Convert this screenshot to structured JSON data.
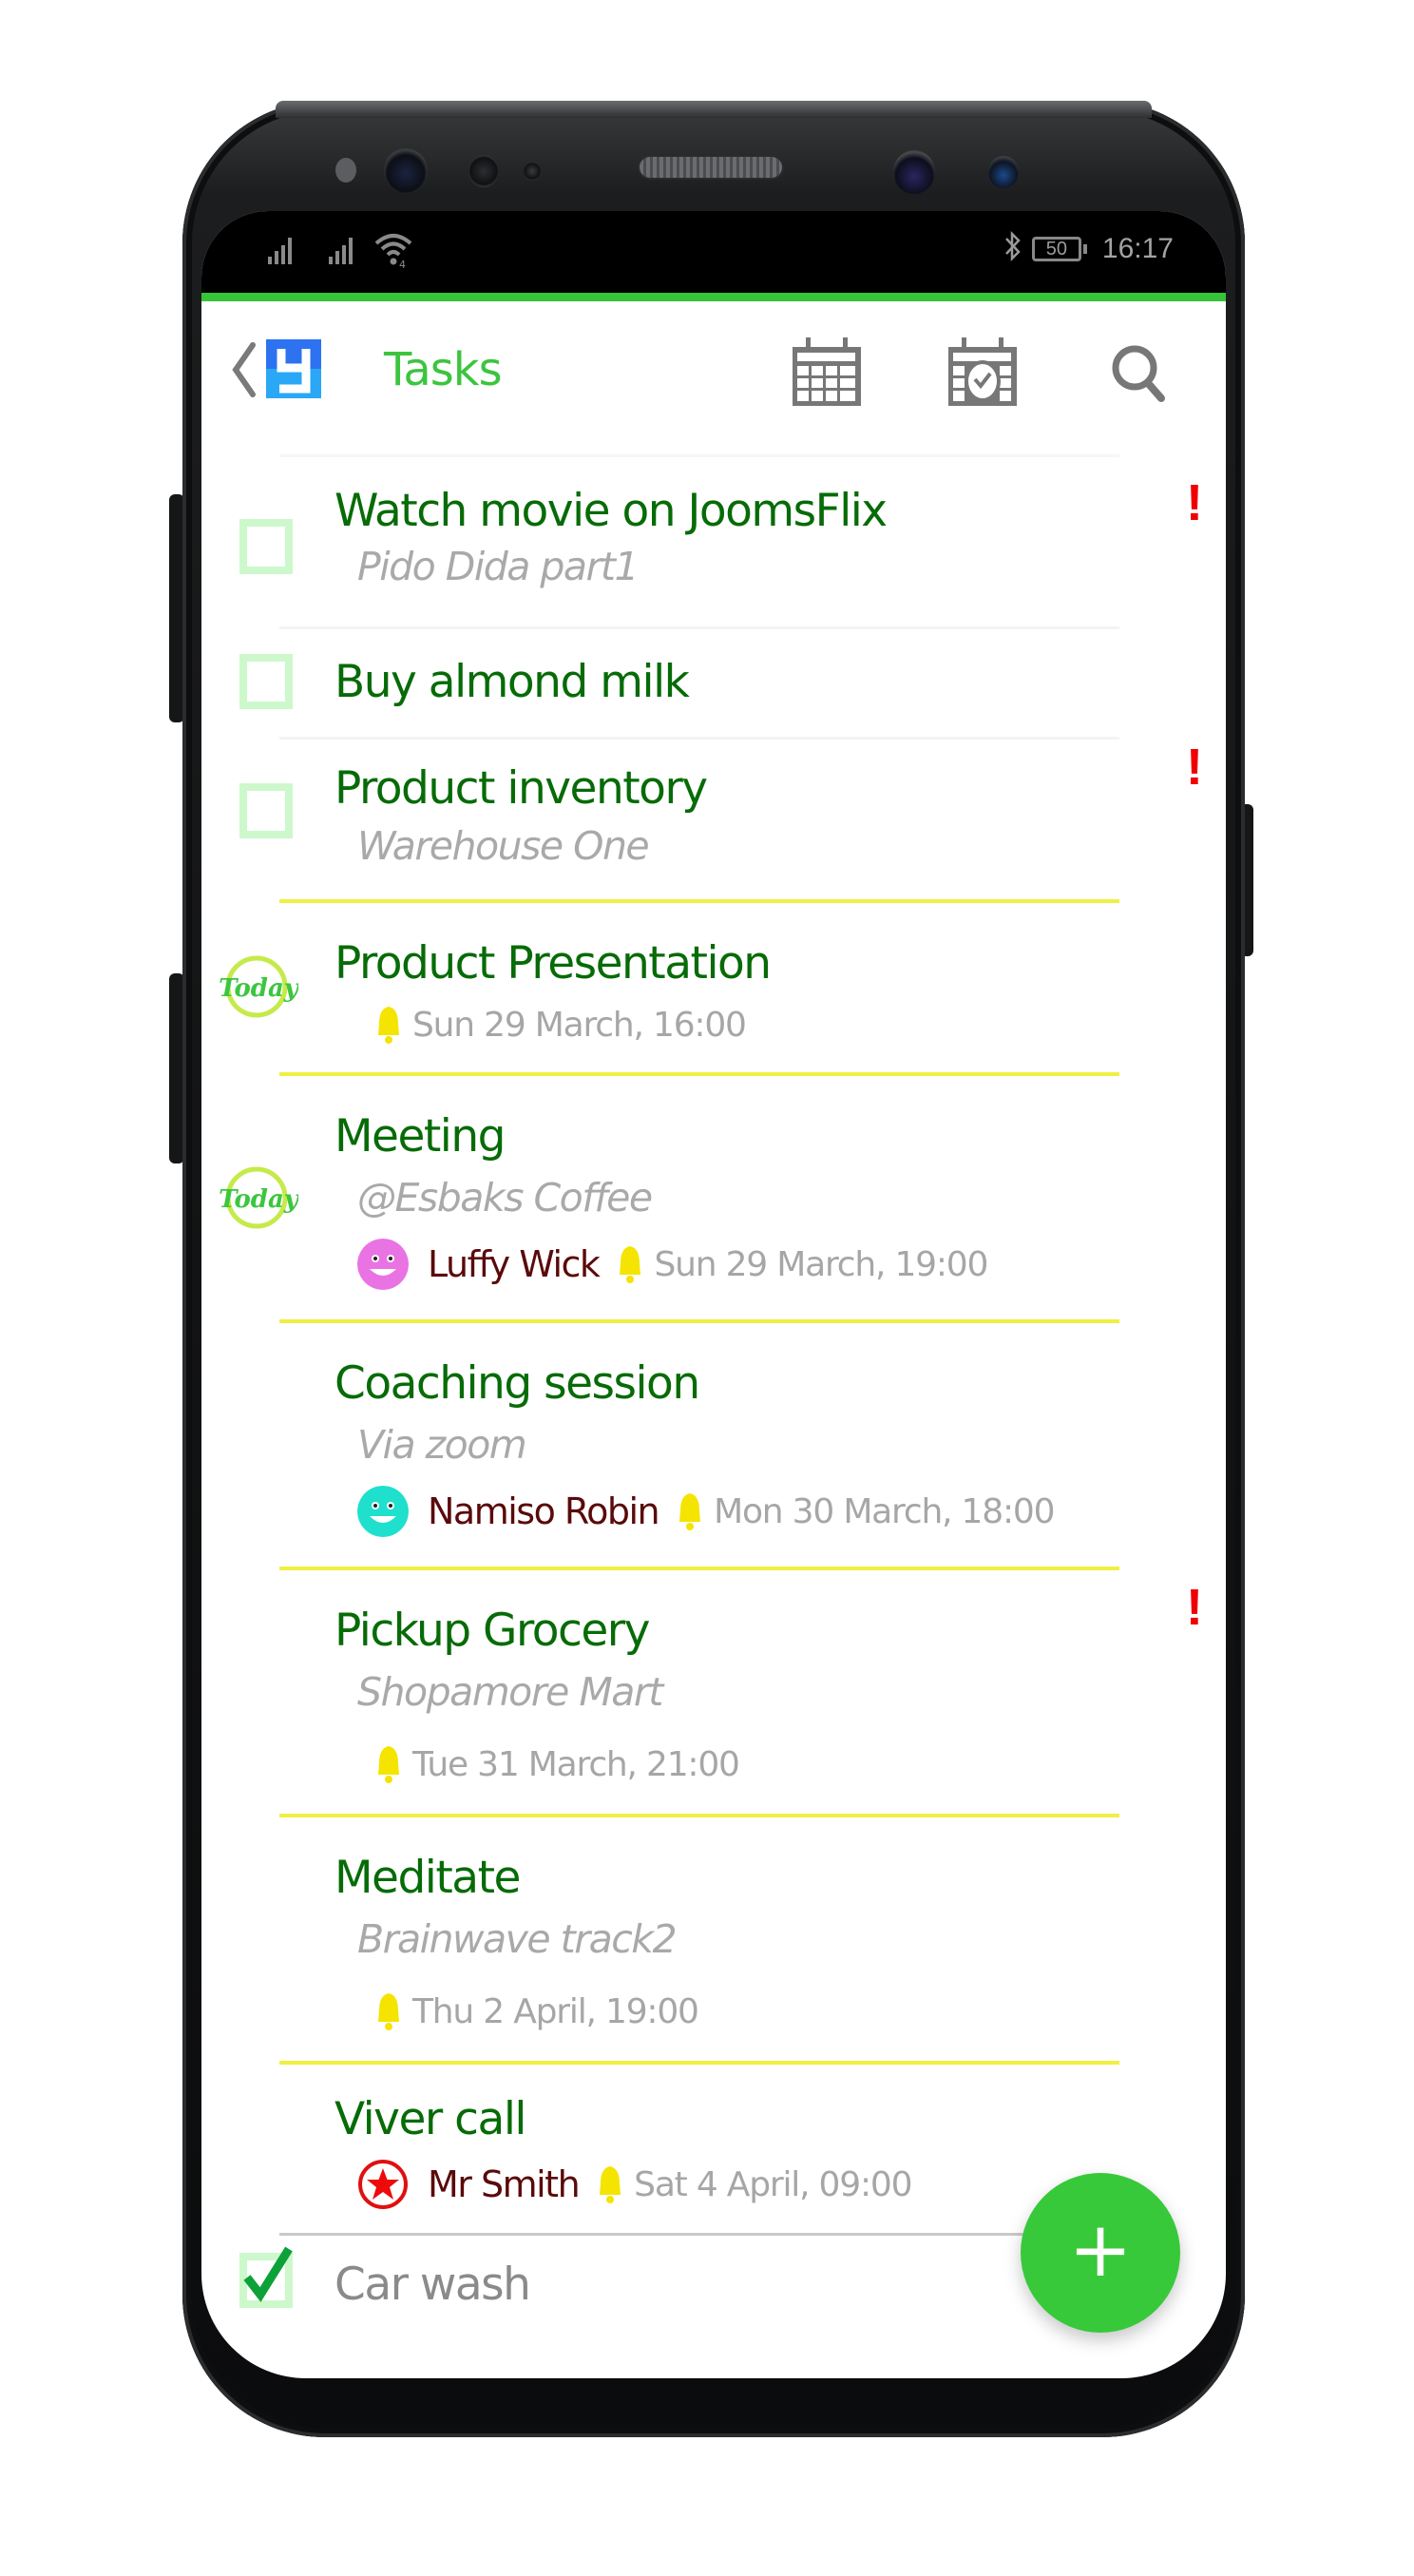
{
  "status_bar": {
    "time": "16:17",
    "battery": "50",
    "icons": [
      "signal-icon",
      "signal-icon",
      "wifi-icon",
      "bluetooth-icon",
      "battery-icon"
    ]
  },
  "app_bar": {
    "title": "Tasks",
    "back_icon": "chevron-left-icon",
    "logo": "app-logo",
    "actions": [
      {
        "name": "calendar-month-button",
        "icon": "calendar-icon"
      },
      {
        "name": "calendar-schedule-button",
        "icon": "calendar-clock-icon"
      },
      {
        "name": "search-button",
        "icon": "search-icon"
      }
    ]
  },
  "colors": {
    "accent": "#35c43a",
    "title_green": "#3dc43f",
    "task_title": "#076b07",
    "note_gray": "#a9a9a9",
    "contact": "#5a0a0a",
    "priority": "#f00000",
    "divider_yellow": "#f0f042",
    "checkbox": "#ccf8cc",
    "bell": "#f5e400"
  },
  "tasks": [
    {
      "title": "Watch movie on JoomsFlix",
      "note": "Pido Dida part1",
      "priority": true,
      "marker": "checkbox",
      "checked": false
    },
    {
      "title": "Buy almond milk",
      "marker": "checkbox",
      "checked": false,
      "priority": false
    },
    {
      "title": "Product inventory",
      "note": "Warehouse One",
      "priority": true,
      "marker": "checkbox",
      "checked": false
    },
    {
      "title": "Product Presentation",
      "reminder": "Sun 29 March,  16:00",
      "marker": "today",
      "today_label": "Today",
      "priority": false
    },
    {
      "title": "Meeting",
      "note": "@Esbaks Coffee",
      "contact": "Luffy Wick",
      "contact_avatar": "pink-smiley-icon",
      "reminder": "Sun 29 March,  19:00",
      "marker": "today",
      "today_label": "Today",
      "priority": false
    },
    {
      "title": "Coaching session",
      "note": "Via zoom",
      "contact": "Namiso Robin",
      "contact_avatar": "teal-smiley-icon",
      "reminder": "Mon 30 March,  18:00",
      "priority": false
    },
    {
      "title": "Pickup Grocery",
      "note": "Shopamore Mart",
      "reminder": "Tue 31 March,  21:00",
      "priority": true
    },
    {
      "title": "Meditate",
      "note": "Brainwave track2",
      "reminder": "Thu 2 April,  19:00",
      "priority": false
    },
    {
      "title": "Viver call",
      "contact": "Mr Smith",
      "contact_avatar": "red-star-icon",
      "reminder": "Sat 4 April,  09:00",
      "priority": false
    },
    {
      "title": "Car wash",
      "marker": "checkbox",
      "checked": true,
      "priority": false
    }
  ],
  "fab": {
    "label": "+",
    "icon": "plus-icon"
  },
  "priority_mark": "!"
}
